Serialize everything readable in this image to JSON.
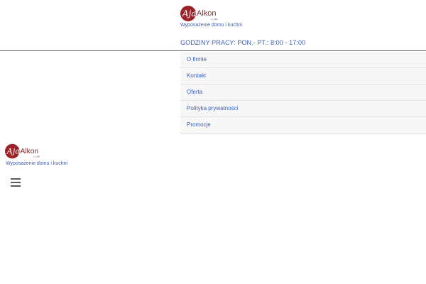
{
  "brand": {
    "logo_script": "Aja",
    "logo_name": "Alkon",
    "logo_small": "s.c. ABC",
    "tagline": "Wyposażenie domu i kuchni",
    "logo_colors": {
      "circle": "#9b2227",
      "name": "#8a2b2b"
    }
  },
  "header": {
    "hours": "GODZINY PRACY: PON.- PT.: 8:00 - 17:00"
  },
  "nav": {
    "items": [
      {
        "label": "O firmie"
      },
      {
        "label": "Kontakt"
      },
      {
        "label": "Oferta"
      },
      {
        "label": "Polityka prywatności"
      },
      {
        "label": "Promocje"
      }
    ]
  },
  "mobile_header": {
    "menu_icon": "hamburger-menu-icon"
  },
  "colors": {
    "link": "#3a5fbf",
    "nav_bg": "#f7f7f7",
    "divider": "#6b6b6b"
  }
}
